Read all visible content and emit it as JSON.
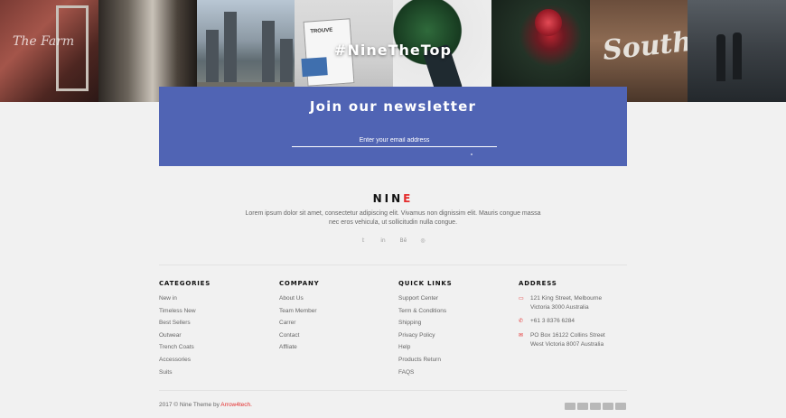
{
  "instagram": {
    "hashtag": "#NineTheTop",
    "tiles": [
      {
        "id": "tile-1",
        "overlay": "The Farm"
      },
      {
        "id": "tile-2",
        "overlay": ""
      },
      {
        "id": "tile-3",
        "overlay": ""
      },
      {
        "id": "tile-4",
        "overlay": "TROUVE"
      },
      {
        "id": "tile-5",
        "overlay": ""
      },
      {
        "id": "tile-6",
        "overlay": ""
      },
      {
        "id": "tile-7",
        "overlay": "South"
      },
      {
        "id": "tile-8",
        "overlay": ""
      }
    ]
  },
  "newsletter": {
    "title": "Join our newsletter",
    "email_placeholder": "Enter your email address",
    "accent_color": "#5064b4"
  },
  "brand": {
    "name_main": "NIN",
    "name_accent": "E",
    "accent_color": "#e42c2c",
    "description": "Lorem ipsum dolor sit amet, consectetur adipiscing elit. Vivamus non dignissim elit. Mauris congue massa nec eros vehicula, ut sollicitudin nulla congue."
  },
  "social": {
    "twitter": "𝕥",
    "linkedin": "in",
    "behance": "Bē",
    "dribbble": "◎"
  },
  "footer": {
    "categories": {
      "title": "CATEGORIES",
      "items": [
        "New in",
        "Timeless New",
        "Best Sellers",
        "Outwear",
        "Trench Coats",
        "Accessories",
        "Suits"
      ]
    },
    "company": {
      "title": "COMPANY",
      "items": [
        "About Us",
        "Team Member",
        "Carrer",
        "Contact",
        "Affliate"
      ]
    },
    "quick_links": {
      "title": "QUICK LINKS",
      "items": [
        "Support Center",
        "Term & Conditions",
        "Shipping",
        "Privacy Policy",
        "Help",
        "Products Return",
        "FAQS"
      ]
    },
    "address": {
      "title": "ADDRESS",
      "lines": [
        {
          "icon": "map-icon",
          "line1": "121 King Street, Melbourne",
          "line2": "Victoria 3000 Australia"
        },
        {
          "icon": "phone-icon",
          "line1": "+61 3 8376 6284",
          "line2": ""
        },
        {
          "icon": "mail-icon",
          "line1": "PO Box 16122 Collins Street",
          "line2": "West Victoria 8007 Australia"
        }
      ]
    }
  },
  "copyright": {
    "text": "2017 © Nine Theme by ",
    "author": "Arrow4tech."
  },
  "payments": [
    "visa-icon",
    "mastercard-icon",
    "amex-icon",
    "paypal-icon",
    "card-icon"
  ]
}
